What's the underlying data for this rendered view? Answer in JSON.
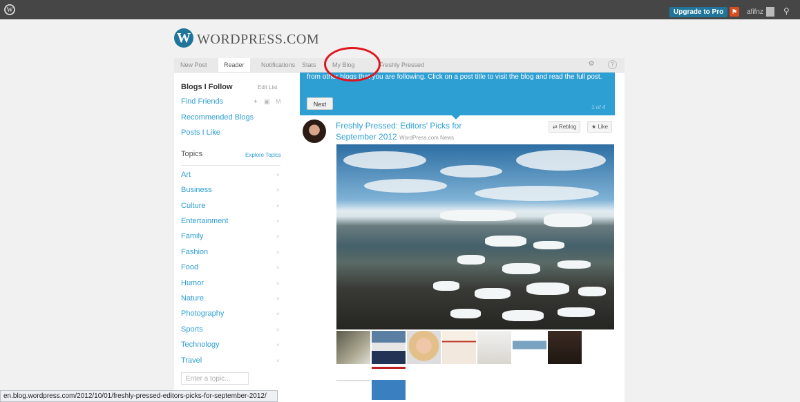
{
  "adminbar": {
    "wp_logo": "W",
    "upgrade_label": "Upgrade to Pro",
    "notification_glyph": "⚑",
    "username": "afifnz",
    "search_glyph": "⚲",
    "bg_color": "#464646"
  },
  "brand": {
    "logo_letter": "W",
    "name": "WordPress.com"
  },
  "tabs": [
    {
      "label": "New Post"
    },
    {
      "label": "Reader",
      "active": true
    },
    {
      "label": "Notifications"
    },
    {
      "label": "Stats"
    },
    {
      "label": "My Blog"
    },
    {
      "label": "Freshly Pressed"
    }
  ],
  "tab_icons": {
    "settings": "⚙",
    "help": "?"
  },
  "sidebar": {
    "blogs_follow": "Blogs I Follow",
    "edit_list": "Edit List",
    "find_friends": "Find Friends",
    "social_icons": "✦ ▣ M",
    "recommended": "Recommended Blogs",
    "posts_like": "Posts I Like",
    "topics_title": "Topics",
    "explore_topics": "Explore Topics",
    "topics": [
      "Art",
      "Business",
      "Culture",
      "Entertainment",
      "Family",
      "Fashion",
      "Food",
      "Humor",
      "Nature",
      "Photography",
      "Sports",
      "Technology",
      "Travel"
    ],
    "remove_glyph": "×",
    "topic_placeholder": "Enter a topic..."
  },
  "tour": {
    "text": "from other blogs that you are following. Click on a post title to visit the blog and read the full post.",
    "next_label": "Next",
    "step": "1 of 4"
  },
  "post": {
    "title": "Freshly Pressed: Editors' Picks for September 2012",
    "source": "WordPress.com News",
    "reblog_label": "⇄ Reblog",
    "like_label": "★ Like"
  },
  "statusbar": {
    "url": "en.blog.wordpress.com/2012/10/01/freshly-pressed-editors-picks-for-september-2012/"
  },
  "colors": {
    "accent": "#2e9fd3",
    "highlight_circle": "#e0141e"
  }
}
